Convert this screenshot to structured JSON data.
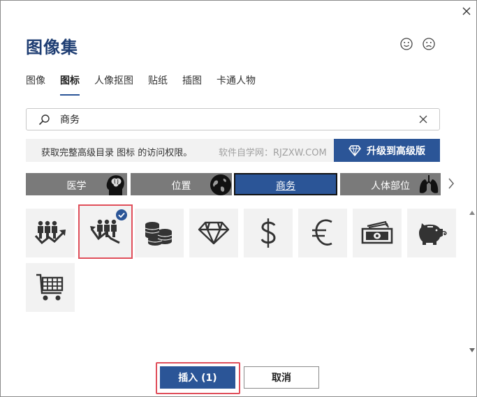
{
  "dialog": {
    "title": "图像集",
    "close_icon": "close-icon",
    "feedback": {
      "happy_icon": "smile-icon",
      "sad_icon": "frown-icon"
    }
  },
  "tabs": [
    {
      "label": "图像",
      "active": false
    },
    {
      "label": "图标",
      "active": true
    },
    {
      "label": "人像抠图",
      "active": false
    },
    {
      "label": "贴纸",
      "active": false
    },
    {
      "label": "插图",
      "active": false
    },
    {
      "label": "卡通人物",
      "active": false
    }
  ],
  "search": {
    "value": "商务",
    "icon": "search-icon",
    "clear_icon": "close-icon"
  },
  "banner": {
    "message": "获取完整高级目录 图标 的访问权限。",
    "watermark": "软件自学网：RJZXW.COM",
    "upgrade_label": "升级到高级版",
    "upgrade_icon": "diamond-icon"
  },
  "categories": [
    {
      "label": "医学",
      "image": "brain-head",
      "active": false
    },
    {
      "label": "位置",
      "image": "globe",
      "active": false
    },
    {
      "label": "商务",
      "image": "",
      "active": true
    },
    {
      "label": "人体部位",
      "image": "lungs",
      "active": false
    }
  ],
  "icons": [
    {
      "name": "business-team-growth-icon",
      "selected": false
    },
    {
      "name": "business-team-decline-icon",
      "selected": true
    },
    {
      "name": "coins-stack-icon",
      "selected": false
    },
    {
      "name": "diamond-icon",
      "selected": false
    },
    {
      "name": "dollar-sign-icon",
      "selected": false
    },
    {
      "name": "euro-sign-icon",
      "selected": false
    },
    {
      "name": "cash-money-icon",
      "selected": false
    },
    {
      "name": "piggy-bank-icon",
      "selected": false
    },
    {
      "name": "shopping-cart-icon",
      "selected": false
    }
  ],
  "buttons": {
    "insert_label": "插入 (1)",
    "cancel_label": "取消"
  },
  "colors": {
    "accent": "#2b5597",
    "title": "#1f3e73",
    "category": "#7a7a7a",
    "highlight": "#e04e5a"
  }
}
